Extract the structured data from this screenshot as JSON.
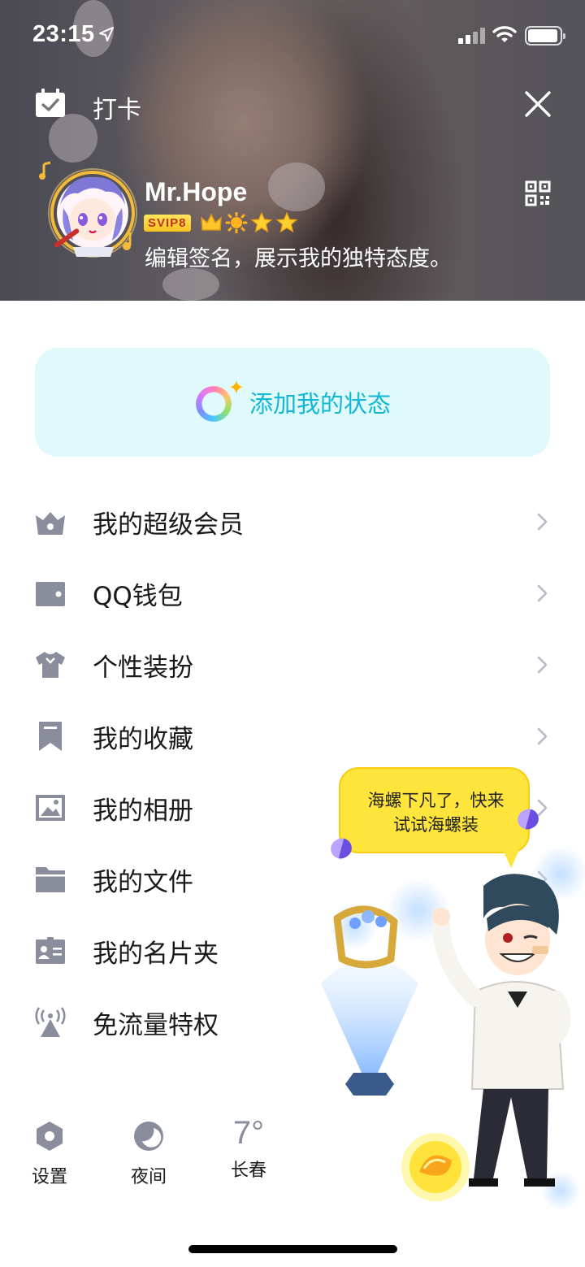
{
  "status_bar": {
    "time": "23:15"
  },
  "header": {
    "checkin_label": "打卡",
    "username": "Mr.Hope",
    "svip_badge": "SVIP8",
    "signature": "编辑签名，展示我的独特态度。"
  },
  "status_button": {
    "label": "添加我的状态"
  },
  "menu": {
    "items": [
      {
        "label": "我的超级会员",
        "icon": "vip-crown-icon"
      },
      {
        "label": "QQ钱包",
        "icon": "wallet-icon"
      },
      {
        "label": "个性装扮",
        "icon": "tshirt-icon"
      },
      {
        "label": "我的收藏",
        "icon": "bookmark-icon"
      },
      {
        "label": "我的相册",
        "icon": "photo-icon"
      },
      {
        "label": "我的文件",
        "icon": "folder-icon"
      },
      {
        "label": "我的名片夹",
        "icon": "id-card-icon"
      },
      {
        "label": "免流量特权",
        "icon": "antenna-icon"
      }
    ]
  },
  "bottom_bar": {
    "settings_label": "设置",
    "night_label": "夜间",
    "weather_temp": "7°",
    "weather_city": "长春"
  },
  "promo": {
    "bubble_text": "海螺下凡了，快来试试海螺装"
  },
  "colors": {
    "icon_gray": "#8a8d9c",
    "status_card_bg": "#e0fafc",
    "status_text": "#12b7d4",
    "bubble_yellow": "#ffe53b"
  }
}
